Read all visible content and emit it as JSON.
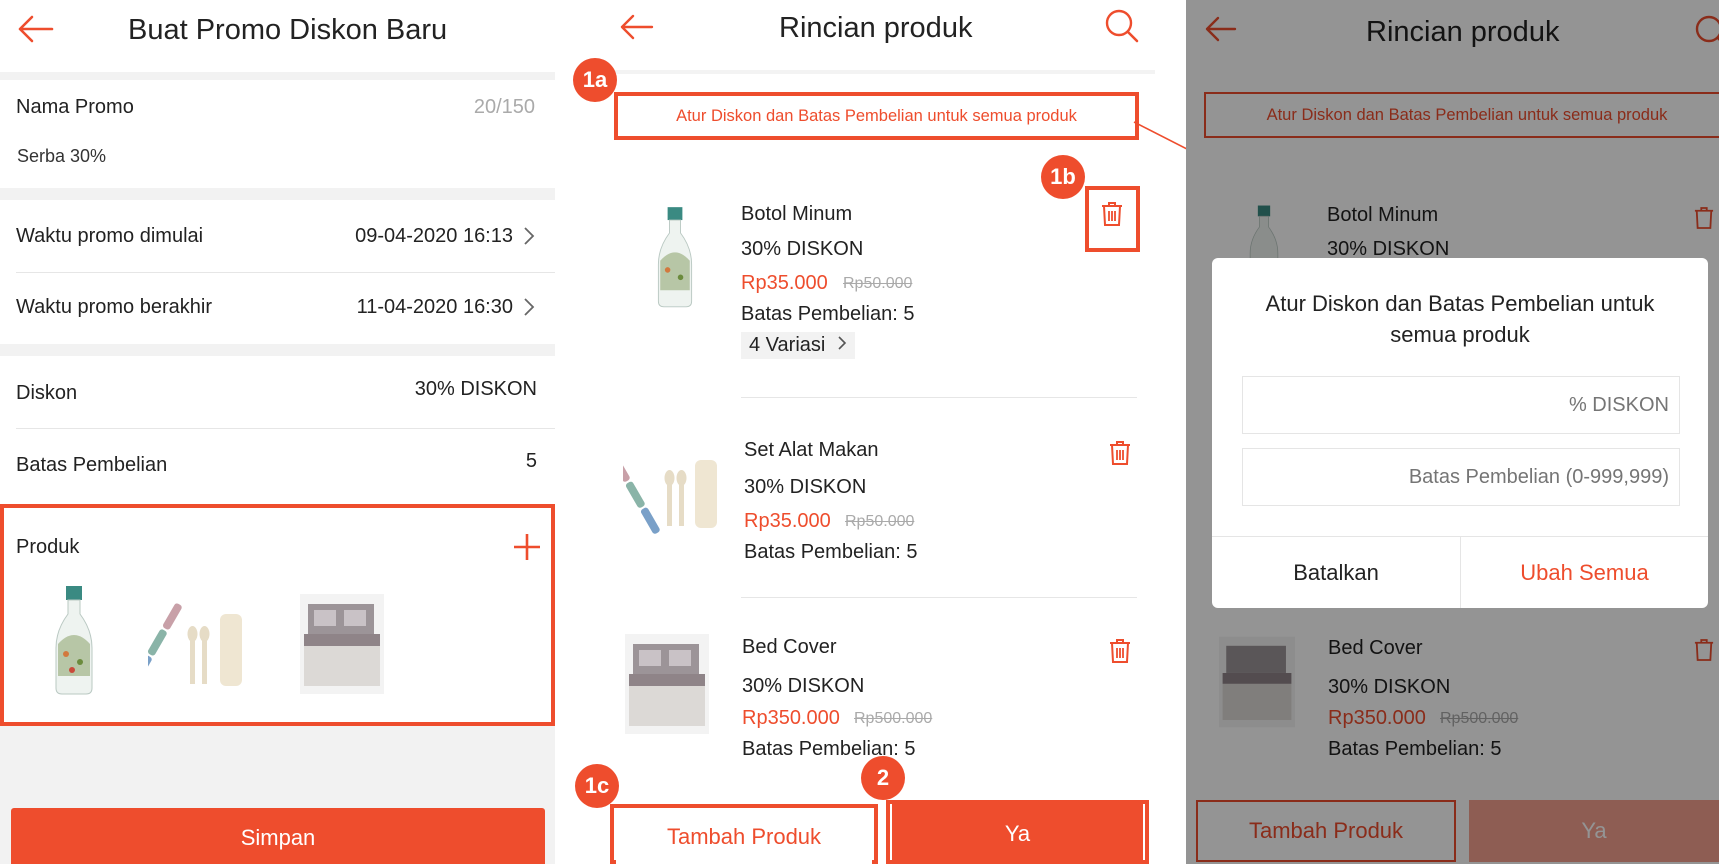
{
  "accent_color": "#ee4d2d",
  "panel1": {
    "title": "Buat Promo Diskon Baru",
    "nama_promo_label": "Nama Promo",
    "nama_promo_counter": "20/150",
    "nama_promo_value": "Serba 30%",
    "start_label": "Waktu promo dimulai",
    "start_value": "09-04-2020 16:13",
    "end_label": "Waktu promo berakhir",
    "end_value": "11-04-2020 16:30",
    "diskon_label": "Diskon",
    "diskon_value": "30% DISKON",
    "batas_label": "Batas Pembelian",
    "batas_value": "5",
    "produk_label": "Produk",
    "save_label": "Simpan",
    "icons": [
      "back-arrow-icon",
      "chevron-right-icon",
      "plus-icon"
    ]
  },
  "panel2": {
    "title": "Rincian produk",
    "bulk_link": "Atur Diskon dan Batas Pembelian untuk semua produk",
    "badges": {
      "b1a": "1a",
      "b1b": "1b",
      "b1c": "1c",
      "b2": "2"
    },
    "products": [
      {
        "name": "Botol Minum",
        "discount": "30% DISKON",
        "price": "Rp35.000",
        "original": "Rp50.000",
        "limit": "Batas Pembelian: 5",
        "variants": "4 Variasi"
      },
      {
        "name": "Set Alat Makan",
        "discount": "30% DISKON",
        "price": "Rp35.000",
        "original": "Rp50.000",
        "limit": "Batas Pembelian: 5"
      },
      {
        "name": "Bed Cover",
        "discount": "30% DISKON",
        "price": "Rp350.000",
        "original": "Rp500.000",
        "limit": "Batas Pembelian: 5"
      }
    ],
    "add_product_label": "Tambah Produk",
    "confirm_label": "Ya",
    "icons": [
      "back-arrow-icon",
      "search-icon",
      "trash-icon",
      "chevron-right-icon"
    ]
  },
  "panel3": {
    "title": "Rincian produk",
    "bulk_link": "Atur Diskon dan Batas Pembelian untuk semua produk",
    "product_top": {
      "name": "Botol Minum",
      "discount": "30% DISKON"
    },
    "product_bottom": {
      "name": "Bed Cover",
      "discount": "30% DISKON",
      "price": "Rp350.000",
      "original": "Rp500.000",
      "limit": "Batas Pembelian: 5"
    },
    "modal": {
      "title": "Atur Diskon dan Batas Pembelian untuk semua produk",
      "discount_placeholder": "% DISKON",
      "limit_placeholder": "Batas Pembelian (0-999,999)",
      "cancel_label": "Batalkan",
      "apply_label": "Ubah Semua"
    },
    "add_product_label": "Tambah Produk",
    "confirm_label": "Ya"
  }
}
